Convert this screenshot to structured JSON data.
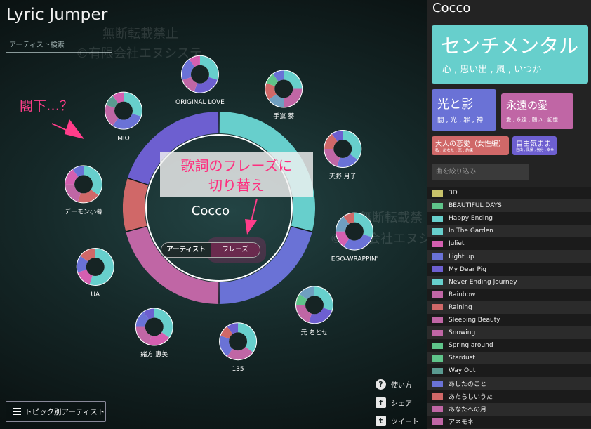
{
  "app": {
    "title": "Lyric Jumper"
  },
  "search": {
    "placeholder": "アーティスト検索"
  },
  "watermark": {
    "line1": "無断転載禁止",
    "line2": "©有限会社エヌシステ",
    "line3": "無断転載禁",
    "line4": "©有限会社エヌシステ"
  },
  "callouts": {
    "lord": "閣下…？",
    "phrase_switch_1": "歌詞のフレーズに",
    "phrase_switch_2": "切り替え"
  },
  "center": {
    "artist": "Cocco"
  },
  "mode_toggle": {
    "artist_label": "アーティスト",
    "phrase_label": "フレーズ",
    "active": "artist"
  },
  "palette": {
    "cyan": "#67cfcc",
    "blue": "#6a72d6",
    "pink": "#c066a5",
    "red": "#d06868",
    "violet": "#6d5fd0",
    "magenta": "#d45fb0",
    "green": "#5fc48a",
    "olive": "#c8c26a",
    "teal": "#5a9a90",
    "steel": "#6f9fc0"
  },
  "ring": [
    {
      "color": "#67cfcc",
      "share": 0.29
    },
    {
      "color": "#6a72d6",
      "share": 0.21
    },
    {
      "color": "#c066a5",
      "share": 0.21
    },
    {
      "color": "#d06868",
      "share": 0.09
    },
    {
      "color": "#6d5fd0",
      "share": 0.2
    }
  ],
  "artists": [
    {
      "name": "ORIGINAL LOVE",
      "slices": [
        {
          "color": "#67cfcc",
          "share": 0.3
        },
        {
          "color": "#6d5fd0",
          "share": 0.25
        },
        {
          "color": "#c066a5",
          "share": 0.15
        },
        {
          "color": "#6a72d6",
          "share": 0.2
        },
        {
          "color": "#d45fb0",
          "share": 0.1
        }
      ]
    },
    {
      "name": "手嶌 葵",
      "slices": [
        {
          "color": "#67cfcc",
          "share": 0.25
        },
        {
          "color": "#c066a5",
          "share": 0.25
        },
        {
          "color": "#6f9fc0",
          "share": 0.15
        },
        {
          "color": "#d06868",
          "share": 0.15
        },
        {
          "color": "#5fc48a",
          "share": 0.1
        },
        {
          "color": "#6a72d6",
          "share": 0.1
        }
      ]
    },
    {
      "name": "天野 月子",
      "slices": [
        {
          "color": "#67cfcc",
          "share": 0.35
        },
        {
          "color": "#6a72d6",
          "share": 0.2
        },
        {
          "color": "#c066a5",
          "share": 0.2
        },
        {
          "color": "#d06868",
          "share": 0.15
        },
        {
          "color": "#6d5fd0",
          "share": 0.1
        }
      ]
    },
    {
      "name": "EGO-WRAPPIN'",
      "slices": [
        {
          "color": "#67cfcc",
          "share": 0.3
        },
        {
          "color": "#6a72d6",
          "share": 0.3
        },
        {
          "color": "#d45fb0",
          "share": 0.15
        },
        {
          "color": "#6f9fc0",
          "share": 0.15
        },
        {
          "color": "#d06868",
          "share": 0.1
        }
      ]
    },
    {
      "name": "元 ちとせ",
      "slices": [
        {
          "color": "#67cfcc",
          "share": 0.3
        },
        {
          "color": "#6d5fd0",
          "share": 0.25
        },
        {
          "color": "#c066a5",
          "share": 0.2
        },
        {
          "color": "#5fc48a",
          "share": 0.1
        },
        {
          "color": "#6f9fc0",
          "share": 0.15
        }
      ]
    },
    {
      "name": "135",
      "slices": [
        {
          "color": "#67cfcc",
          "share": 0.35
        },
        {
          "color": "#c066a5",
          "share": 0.25
        },
        {
          "color": "#6a72d6",
          "share": 0.2
        },
        {
          "color": "#d06868",
          "share": 0.1
        },
        {
          "color": "#6d5fd0",
          "share": 0.1
        }
      ]
    },
    {
      "name": "緒方 恵美",
      "slices": [
        {
          "color": "#67cfcc",
          "share": 0.35
        },
        {
          "color": "#d45fb0",
          "share": 0.2
        },
        {
          "color": "#c066a5",
          "share": 0.2
        },
        {
          "color": "#6a72d6",
          "share": 0.15
        },
        {
          "color": "#6d5fd0",
          "share": 0.1
        }
      ]
    },
    {
      "name": "UA",
      "slices": [
        {
          "color": "#67cfcc",
          "share": 0.55
        },
        {
          "color": "#d45fb0",
          "share": 0.15
        },
        {
          "color": "#6a72d6",
          "share": 0.15
        },
        {
          "color": "#d06868",
          "share": 0.15
        }
      ]
    },
    {
      "name": "デーモン小暮",
      "slices": [
        {
          "color": "#67cfcc",
          "share": 0.35
        },
        {
          "color": "#d06868",
          "share": 0.2
        },
        {
          "color": "#c066a5",
          "share": 0.2
        },
        {
          "color": "#d45fb0",
          "share": 0.15
        },
        {
          "color": "#6a72d6",
          "share": 0.1
        }
      ]
    },
    {
      "name": "MIO",
      "slices": [
        {
          "color": "#67cfcc",
          "share": 0.3
        },
        {
          "color": "#6a72d6",
          "share": 0.3
        },
        {
          "color": "#c066a5",
          "share": 0.2
        },
        {
          "color": "#5a9a90",
          "share": 0.1
        },
        {
          "color": "#d45fb0",
          "share": 0.1
        }
      ]
    }
  ],
  "panel": {
    "artist": "Cocco",
    "topics": [
      {
        "title": "センチメンタル",
        "words": "心 , 思い出 , 風 , いつか",
        "color": "#67cfcc"
      },
      {
        "title": "光と影",
        "words": "闇 , 光 , 罪 , 神",
        "color": "#6a72d6"
      },
      {
        "title": "永遠の愛",
        "words": "愛 , 永遠 , 願い , 記憶",
        "color": "#c066a5"
      },
      {
        "title": "大人の恋愛（女性編）",
        "words": "私 , あなた , 恋 , 約束",
        "color": "#d06868"
      },
      {
        "title": "自由気まま",
        "words": "自由 , 風景 , 気分 , 幸せ",
        "color": "#6d5fd0"
      }
    ],
    "filter_placeholder": "曲を絞り込み",
    "songs": [
      {
        "title": "3D",
        "color": "#c8c26a"
      },
      {
        "title": "BEAUTIFUL DAYS",
        "color": "#5fc48a"
      },
      {
        "title": "Happy Ending",
        "color": "#67cfcc"
      },
      {
        "title": "In The Garden",
        "color": "#67cfcc"
      },
      {
        "title": "Juliet",
        "color": "#d45fb0"
      },
      {
        "title": "Light up",
        "color": "#6a72d6"
      },
      {
        "title": "My Dear Pig",
        "color": "#6d5fd0"
      },
      {
        "title": "Never Ending Journey",
        "color": "#67cfcc"
      },
      {
        "title": "Rainbow",
        "color": "#c066a5"
      },
      {
        "title": "Raining",
        "color": "#d06868"
      },
      {
        "title": "Sleeping Beauty",
        "color": "#c066a5"
      },
      {
        "title": "Snowing",
        "color": "#c066a5"
      },
      {
        "title": "Spring around",
        "color": "#5fc48a"
      },
      {
        "title": "Stardust",
        "color": "#5fc48a"
      },
      {
        "title": "Way Out",
        "color": "#5a9a90"
      },
      {
        "title": "あしたのこと",
        "color": "#6a72d6"
      },
      {
        "title": "あたらしいうた",
        "color": "#d06868"
      },
      {
        "title": "あなたへの月",
        "color": "#c066a5"
      },
      {
        "title": "アネモネ",
        "color": "#c066a5"
      }
    ]
  },
  "side_buttons": {
    "help": "使い方",
    "share": "シェア",
    "tweet": "ツイート"
  },
  "topic_button": {
    "label": "トピック別アーティスト"
  }
}
